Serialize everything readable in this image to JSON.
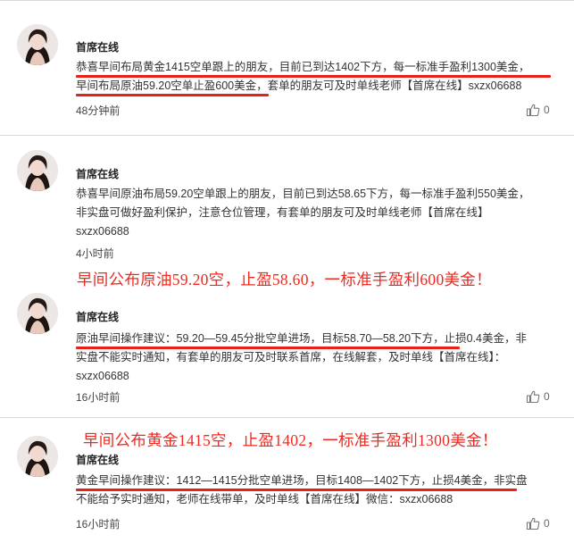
{
  "posts": [
    {
      "author": "首席在线",
      "lines": [
        "恭喜早间布局黄金1415空单跟上的朋友，目前已到达1402下方，每一标准手盈利1300美金，",
        "早间布局原油59.20空单止盈600美金，套单的朋友可及时单线老师【首席在线】sxzx06688"
      ],
      "time": "48分钟前",
      "likes": "0"
    },
    {
      "author": "首席在线",
      "lines": [
        "恭喜早间原油布局59.20空单跟上的朋友，目前已到达58.65下方，每一标准手盈利550美金，",
        "非实盘可做好盈利保护，注意仓位管理，有套单的朋友可及时单线老师【首席在线】",
        "sxzx06688"
      ],
      "time": "4小时前",
      "likes": "0"
    },
    {
      "author": "首席在线",
      "lines": [
        "原油早间操作建议：59.20—59.45分批空单进场，目标58.70—58.20下方，止损0.4美金，非",
        "实盘不能实时通知，有套单的朋友可及时联系首席，在线解套，及时单线【首席在线】：",
        "sxzx06688"
      ],
      "time": "16小时前",
      "likes": "0"
    },
    {
      "author": "首席在线",
      "lines": [
        "黄金早间操作建议：1412—1415分批空单进场，目标1408—1402下方，止损4美金，非实盘",
        "不能给予实时通知，老师在线带单，及时单线【首席在线】微信：sxzx06688"
      ],
      "time": "16小时前",
      "likes": "0"
    }
  ],
  "annotations": [
    "早间公布原油59.20空，止盈58.60，一标准手盈利600美金！",
    "早间公布黄金1415空，止盈1402，一标准手盈利1300美金！"
  ],
  "colors": {
    "annotation": "#ee2a20",
    "divider": "#d8d8d8"
  },
  "icons": {
    "like": "thumbs-up-icon",
    "avatar": "user-avatar-photo"
  }
}
